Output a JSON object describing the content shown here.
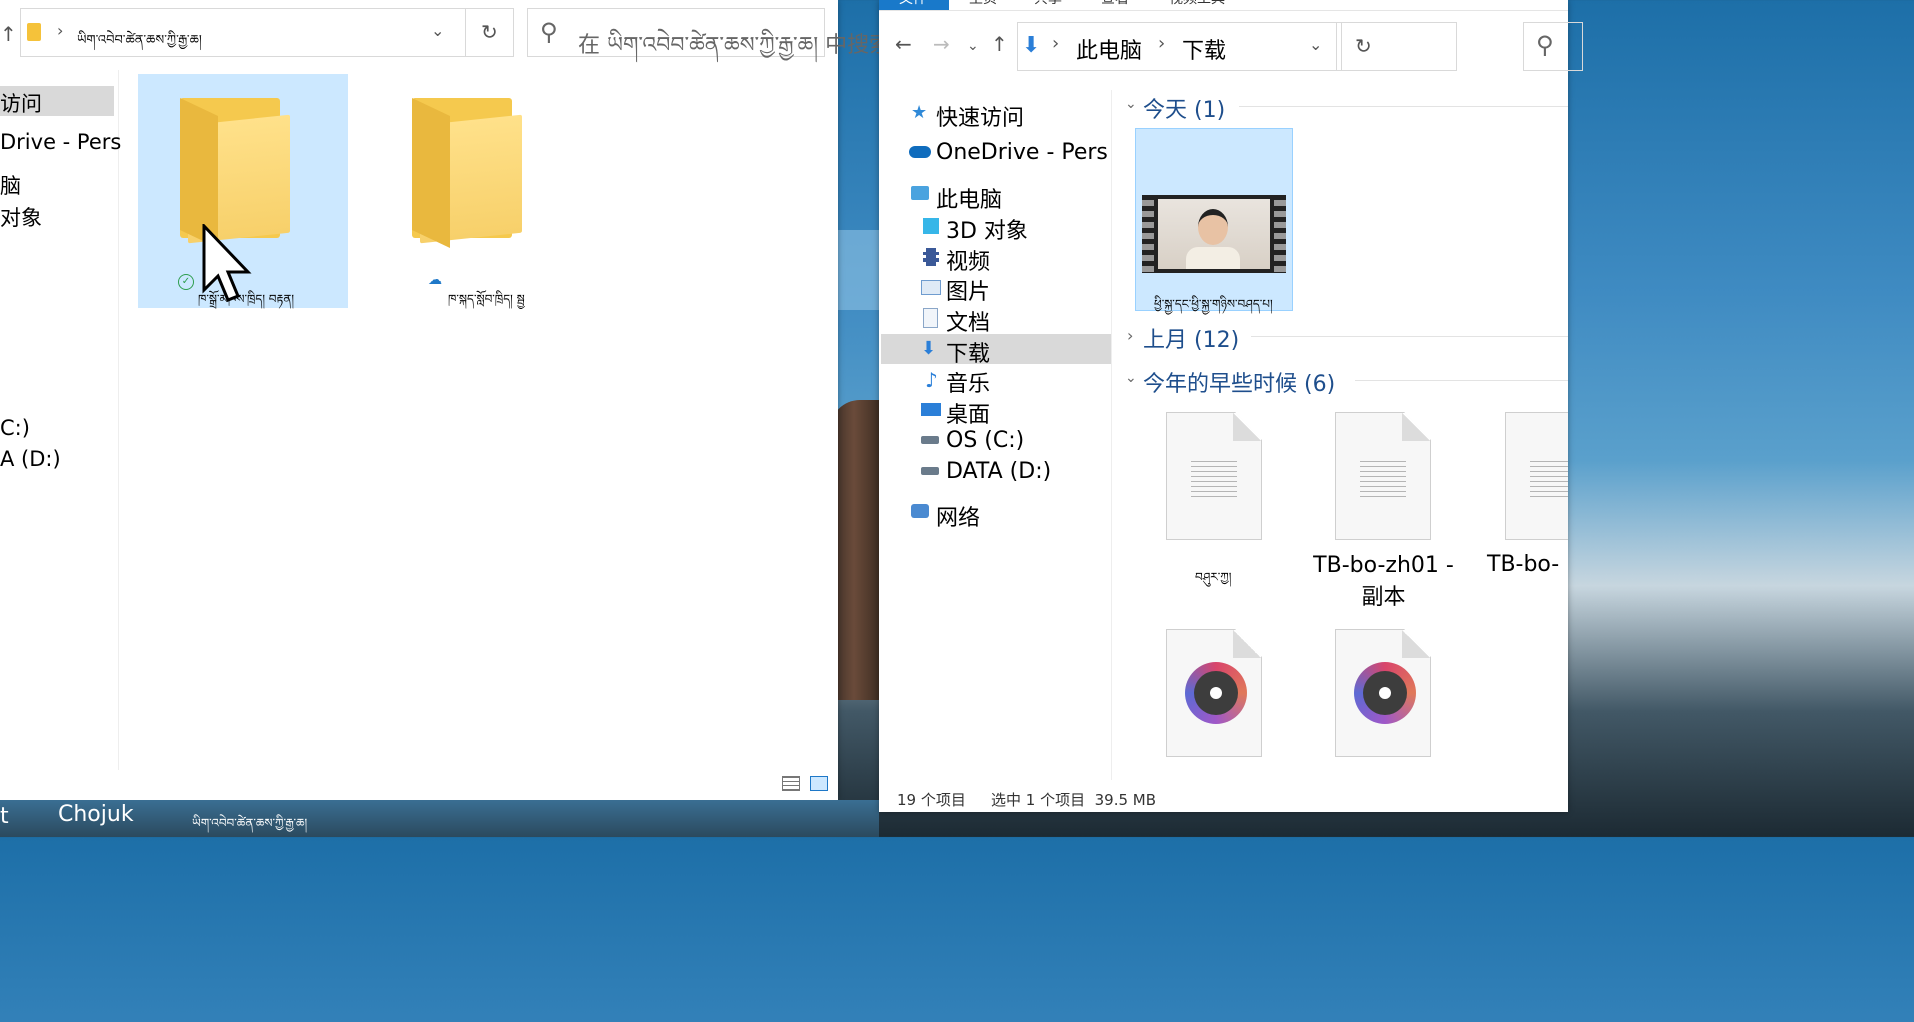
{
  "left_window": {
    "address": {
      "path": "ཡིག་འབེབ་ཚེན་ཆས་ཀྱི་རྒྱ་ཆ།"
    },
    "search": {
      "placeholder": "在 ཡིག་འབེབ་ཚེན་ཆས་ཀྱི་རྒྱ་ཆ། 中搜索"
    },
    "nav_items": [
      {
        "label": "访问"
      },
      {
        "label": "Drive - Pers"
      },
      {
        "label": "脑"
      },
      {
        "label": "对象"
      },
      {
        "label": "C:)"
      },
      {
        "label": "A (D:)"
      }
    ],
    "items": [
      {
        "name": "ཁ་སྒྲོ་མཁས་ཁྲིད། བརྟན།",
        "status": "synced"
      },
      {
        "name": "ཁ་སྐད་སློབ་ཁྲིད། སྦྱ",
        "status": "cloud"
      }
    ]
  },
  "right_window": {
    "ribbon_tabs": [
      "文件",
      "主页",
      "共享",
      "查看",
      "视频工具"
    ],
    "breadcrumb": [
      "此电脑",
      "下载"
    ],
    "nav_items": [
      {
        "label": "快速访问",
        "icon": "star-icon",
        "color": "#2f89d8"
      },
      {
        "label": "OneDrive - Pers",
        "icon": "cloud-icon",
        "color": "#0f6cbd"
      },
      {
        "label": "此电脑",
        "icon": "computer-icon",
        "color": "#4aa3df"
      },
      {
        "label": "3D 对象",
        "icon": "cube-icon",
        "color": "#36b6e8"
      },
      {
        "label": "视频",
        "icon": "film-icon",
        "color": "#3b5998"
      },
      {
        "label": "图片",
        "icon": "picture-icon",
        "color": "#6f9ccf"
      },
      {
        "label": "文档",
        "icon": "document-icon",
        "color": "#8aa6c8"
      },
      {
        "label": "下载",
        "icon": "download-icon",
        "color": "#2b7fd8"
      },
      {
        "label": "音乐",
        "icon": "music-icon",
        "color": "#2b7fd8"
      },
      {
        "label": "桌面",
        "icon": "desktop-icon",
        "color": "#2b7fd8"
      },
      {
        "label": "OS (C:)",
        "icon": "drive-os-icon",
        "color": "#6a7b8b"
      },
      {
        "label": "DATA (D:)",
        "icon": "drive-icon",
        "color": "#6a7b8b"
      },
      {
        "label": "网络",
        "icon": "network-icon",
        "color": "#4a8ad1"
      }
    ],
    "groups": {
      "today": "今天 (1)",
      "last_month": "上月 (12)",
      "earlier": "今年的早些时候 (6)"
    },
    "today_item": {
      "name": "ཕྱི་སྐྱ་དང་ཕྱི་སྐྱ་གཉིས་བཤད་པ།"
    },
    "earlier_items": [
      {
        "name": "བཤུར་ཀྱ།"
      },
      {
        "name": "TB-bo-zh01 - 副本"
      },
      {
        "name": "TB-bo-"
      }
    ],
    "status": {
      "count": "19 个项目",
      "selected": "选中 1 个项目  39.5 MB"
    }
  },
  "taskbar": {
    "label1": "Chojuk",
    "label2": "ཡིག་འབེབ་ཚེན་ཆས་ཀྱི་རྒྱ་ཆ།",
    "label0": "t"
  }
}
